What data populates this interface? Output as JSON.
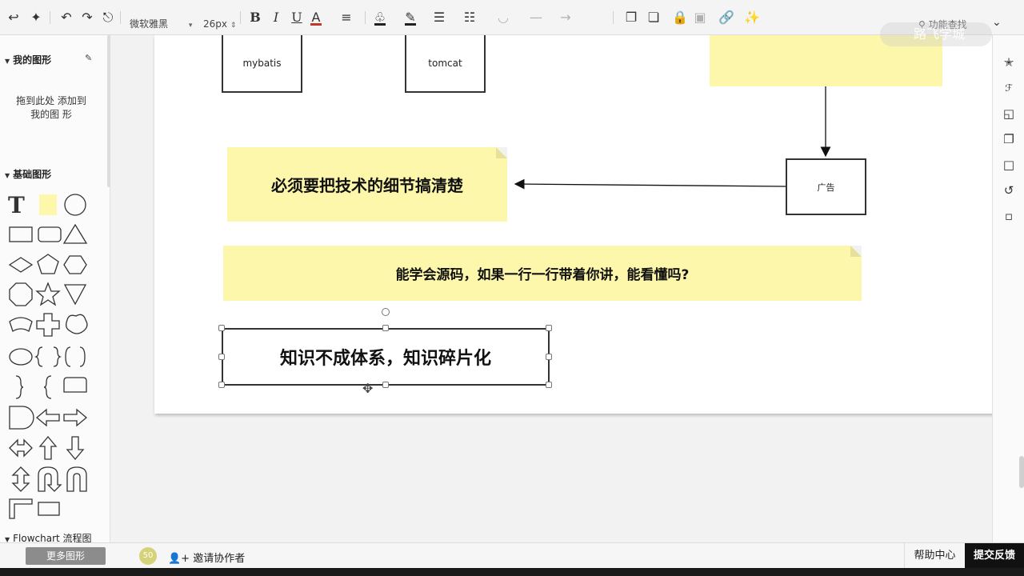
{
  "toolbar": {
    "font_family": "微软雅黑",
    "font_size": "26px",
    "bold": "B",
    "italic": "I",
    "underline": "U",
    "font_color": "A",
    "search_label": "功能查找",
    "watermark": "路飞学城",
    "colors": {
      "font_color_bar": "#c0392b",
      "fill_bar": "#222222",
      "line_bar": "#222222"
    }
  },
  "sidebar": {
    "my_shapes_title": "我的图形",
    "drop_hint": "拖到此处 添加到我的图 形",
    "basic_shapes_title": "基础图形",
    "flowchart_title": "Flowchart 流程图",
    "more_shapes": "更多图形"
  },
  "canvas": {
    "boxes": {
      "mybatis": "mybatis",
      "tomcat": "tomcat",
      "ad": "广告"
    },
    "notes": {
      "note1": "必须要把技术的细节搞清楚",
      "note2": "能学会源码，如果一行一行带着你讲，能看懂吗?",
      "note3": "知识不成体系，知识碎片化"
    },
    "note_color": "#fcf7aa"
  },
  "bottombar": {
    "avatar": "50",
    "invite": "邀请协作者",
    "help": "帮助中心",
    "feedback": "提交反馈"
  }
}
